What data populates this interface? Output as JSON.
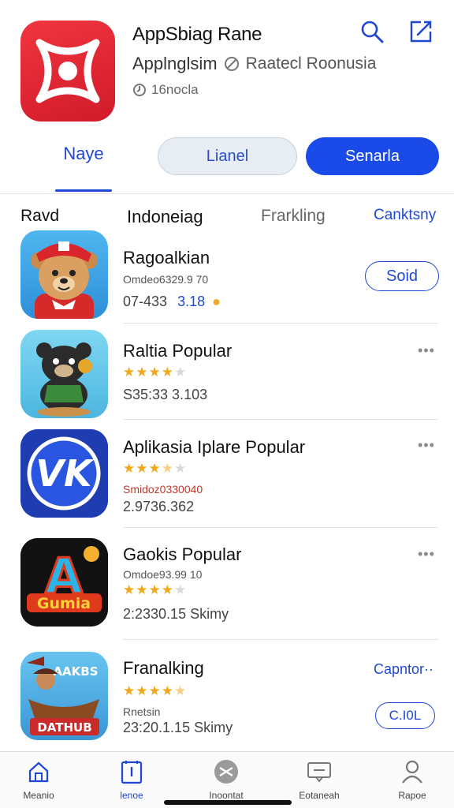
{
  "header": {
    "title": "AppSbiag Rane",
    "subtitle_a": "Applnglsim",
    "subtitle_b": "Raatecl Roonusia",
    "meta": "16nocla",
    "icons": [
      "search-icon",
      "compose-icon"
    ]
  },
  "tabs": {
    "first": "Naye",
    "pill_light": "Lianel",
    "pill_dark": "Senarla"
  },
  "categories": [
    "Ravd",
    "Indoneiag",
    "Frarkling",
    "Canktsny"
  ],
  "items": [
    {
      "title": "Ragoalkian",
      "line2": "Omdeo6329.9 70",
      "line3_a": "07-433",
      "line3_b": "3.18",
      "action": "Soid"
    },
    {
      "title": "Raltia Popular",
      "rating": 4,
      "line3": "S35:33 3.103",
      "more": "•••"
    },
    {
      "title": "Aplikasia Iplare Popular",
      "rating": 3.5,
      "line2": "Smidoz0330040",
      "line3": "2.9736.362",
      "more": "•••"
    },
    {
      "title": "Gaokis Popular",
      "rating": 4,
      "line2": "Omdoe93.99 10",
      "line3": "2:2330.15 Skimy",
      "more": "•••"
    },
    {
      "title": "Franalking",
      "rating": 4.5,
      "line2": "Rnetsin",
      "line3": "23:20.1.15 Skimy",
      "link": "Capntor··",
      "action": "C.I0L"
    }
  ],
  "icon_texts": {
    "game_a_letter": "A",
    "game_a_banner": "Gumia",
    "pirate_top": "AAKBS",
    "pirate_banner": "DATHUB"
  },
  "bottom_nav": [
    {
      "label": "Meanio",
      "icon": "home-icon"
    },
    {
      "label": "lenoe",
      "icon": "apps-icon",
      "active": true
    },
    {
      "label": "Inoontat",
      "icon": "arcade-icon"
    },
    {
      "label": "Eotaneah",
      "icon": "inbox-icon"
    },
    {
      "label": "Rapoe",
      "icon": "profile-icon"
    }
  ],
  "colors": {
    "accent": "#1f47d6",
    "brand_red": "#e02a36",
    "star": "#f2a81d"
  }
}
